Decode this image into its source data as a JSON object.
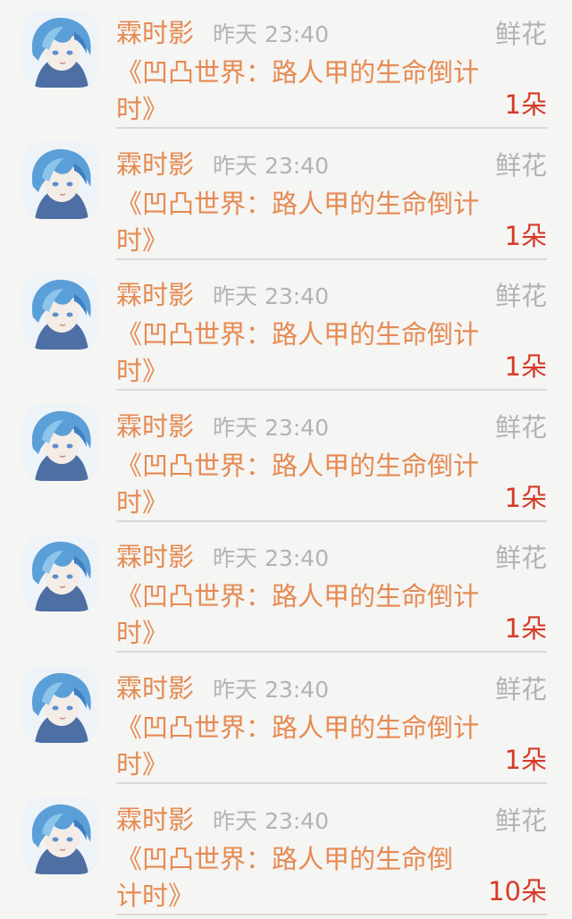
{
  "rows": [
    {
      "name": "霖时影",
      "time": "昨天 23:40",
      "gift_type": "鲜花",
      "book": "《凹凸世界：路人甲的生命倒计时》",
      "count": "1朵"
    },
    {
      "name": "霖时影",
      "time": "昨天 23:40",
      "gift_type": "鲜花",
      "book": "《凹凸世界：路人甲的生命倒计时》",
      "count": "1朵"
    },
    {
      "name": "霖时影",
      "time": "昨天 23:40",
      "gift_type": "鲜花",
      "book": "《凹凸世界：路人甲的生命倒计时》",
      "count": "1朵"
    },
    {
      "name": "霖时影",
      "time": "昨天 23:40",
      "gift_type": "鲜花",
      "book": "《凹凸世界：路人甲的生命倒计时》",
      "count": "1朵"
    },
    {
      "name": "霖时影",
      "time": "昨天 23:40",
      "gift_type": "鲜花",
      "book": "《凹凸世界：路人甲的生命倒计时》",
      "count": "1朵"
    },
    {
      "name": "霖时影",
      "time": "昨天 23:40",
      "gift_type": "鲜花",
      "book": "《凹凸世界：路人甲的生命倒计时》",
      "count": "1朵"
    },
    {
      "name": "霖时影",
      "time": "昨天 23:40",
      "gift_type": "鲜花",
      "book": "《凹凸世界：路人甲的生命倒计时》",
      "count": "10朵"
    }
  ]
}
